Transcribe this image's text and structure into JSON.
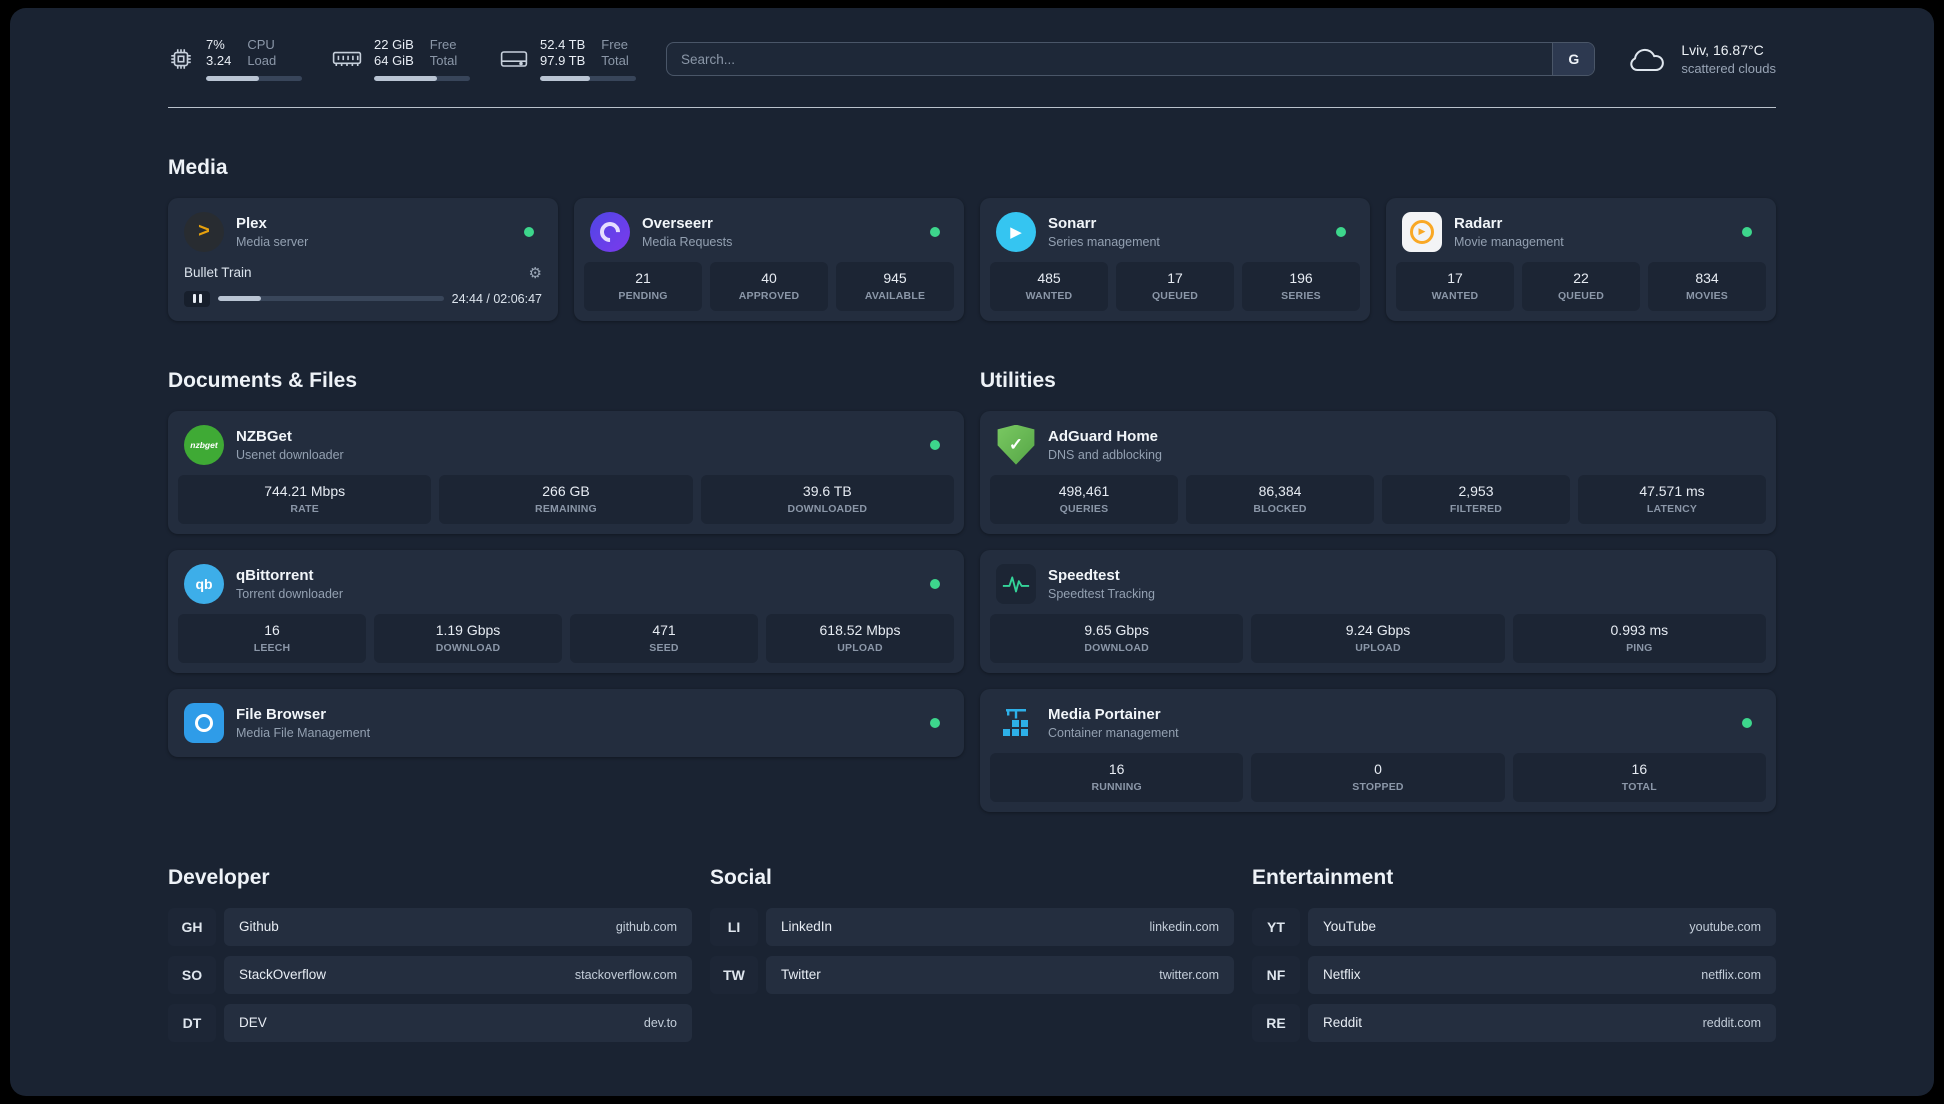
{
  "topbar": {
    "cpu": {
      "value_top": "7%",
      "value_bottom": "3.24",
      "label_top": "CPU",
      "label_bottom": "Load",
      "progress": 55
    },
    "memory": {
      "value_top": "22 GiB",
      "value_bottom": "64 GiB",
      "label_top": "Free",
      "label_bottom": "Total",
      "progress": 66
    },
    "disk": {
      "value_top": "52.4 TB",
      "value_bottom": "97.9 TB",
      "label_top": "Free",
      "label_bottom": "Total",
      "progress": 52
    },
    "search": {
      "placeholder": "Search...",
      "button_label": "G"
    },
    "weather": {
      "location": "Lviv, 16.87°C",
      "condition": "scattered clouds"
    }
  },
  "sections": {
    "media": "Media",
    "documents": "Documents & Files",
    "utilities": "Utilities",
    "developer": "Developer",
    "social": "Social",
    "entertainment": "Entertainment"
  },
  "media": {
    "plex": {
      "name": "Plex",
      "subtitle": "Media server",
      "player": {
        "track": "Bullet Train",
        "time": "24:44 / 02:06:47",
        "progress": 19
      }
    },
    "overseerr": {
      "name": "Overseerr",
      "subtitle": "Media Requests",
      "stats": [
        {
          "value": "21",
          "label": "PENDING"
        },
        {
          "value": "40",
          "label": "APPROVED"
        },
        {
          "value": "945",
          "label": "AVAILABLE"
        }
      ]
    },
    "sonarr": {
      "name": "Sonarr",
      "subtitle": "Series management",
      "stats": [
        {
          "value": "485",
          "label": "WANTED"
        },
        {
          "value": "17",
          "label": "QUEUED"
        },
        {
          "value": "196",
          "label": "SERIES"
        }
      ]
    },
    "radarr": {
      "name": "Radarr",
      "subtitle": "Movie management",
      "stats": [
        {
          "value": "17",
          "label": "WANTED"
        },
        {
          "value": "22",
          "label": "QUEUED"
        },
        {
          "value": "834",
          "label": "MOVIES"
        }
      ]
    }
  },
  "documents": {
    "nzbget": {
      "name": "NZBGet",
      "subtitle": "Usenet downloader",
      "logo_text": "nzbget",
      "stats": [
        {
          "value": "744.21 Mbps",
          "label": "RATE"
        },
        {
          "value": "266 GB",
          "label": "REMAINING"
        },
        {
          "value": "39.6 TB",
          "label": "DOWNLOADED"
        }
      ]
    },
    "qbittorrent": {
      "name": "qBittorrent",
      "subtitle": "Torrent downloader",
      "logo_text": "qb",
      "stats": [
        {
          "value": "16",
          "label": "LEECH"
        },
        {
          "value": "1.19 Gbps",
          "label": "DOWNLOAD"
        },
        {
          "value": "471",
          "label": "SEED"
        },
        {
          "value": "618.52 Mbps",
          "label": "UPLOAD"
        }
      ]
    },
    "filebrowser": {
      "name": "File Browser",
      "subtitle": "Media File Management"
    }
  },
  "utilities": {
    "adguard": {
      "name": "AdGuard Home",
      "subtitle": "DNS and adblocking",
      "stats": [
        {
          "value": "498,461",
          "label": "QUERIES"
        },
        {
          "value": "86,384",
          "label": "BLOCKED"
        },
        {
          "value": "2,953",
          "label": "FILTERED"
        },
        {
          "value": "47.571 ms",
          "label": "LATENCY"
        }
      ]
    },
    "speedtest": {
      "name": "Speedtest",
      "subtitle": "Speedtest Tracking",
      "stats": [
        {
          "value": "9.65 Gbps",
          "label": "DOWNLOAD"
        },
        {
          "value": "9.24 Gbps",
          "label": "UPLOAD"
        },
        {
          "value": "0.993 ms",
          "label": "PING"
        }
      ]
    },
    "portainer": {
      "name": "Media Portainer",
      "subtitle": "Container management",
      "stats": [
        {
          "value": "16",
          "label": "RUNNING"
        },
        {
          "value": "0",
          "label": "STOPPED"
        },
        {
          "value": "16",
          "label": "TOTAL"
        }
      ]
    }
  },
  "bookmarks": {
    "developer": [
      {
        "abbr": "GH",
        "name": "Github",
        "domain": "github.com"
      },
      {
        "abbr": "SO",
        "name": "StackOverflow",
        "domain": "stackoverflow.com"
      },
      {
        "abbr": "DT",
        "name": "DEV",
        "domain": "dev.to"
      }
    ],
    "social": [
      {
        "abbr": "LI",
        "name": "LinkedIn",
        "domain": "linkedin.com"
      },
      {
        "abbr": "TW",
        "name": "Twitter",
        "domain": "twitter.com"
      }
    ],
    "entertainment": [
      {
        "abbr": "YT",
        "name": "YouTube",
        "domain": "youtube.com"
      },
      {
        "abbr": "NF",
        "name": "Netflix",
        "domain": "netflix.com"
      },
      {
        "abbr": "RE",
        "name": "Reddit",
        "domain": "reddit.com"
      }
    ]
  },
  "colors": {
    "status_online": "#3dd68c",
    "plex": "#e5a00d",
    "overseerr": "#6d28d9",
    "sonarr": "#35c5f1",
    "radarr": "#f9a825",
    "nzbget": "#3faa35",
    "qbittorrent": "#3daee9",
    "filebrowser": "#2f9ce8",
    "adguard": "#68bc71",
    "portainer": "#2db0e8"
  }
}
